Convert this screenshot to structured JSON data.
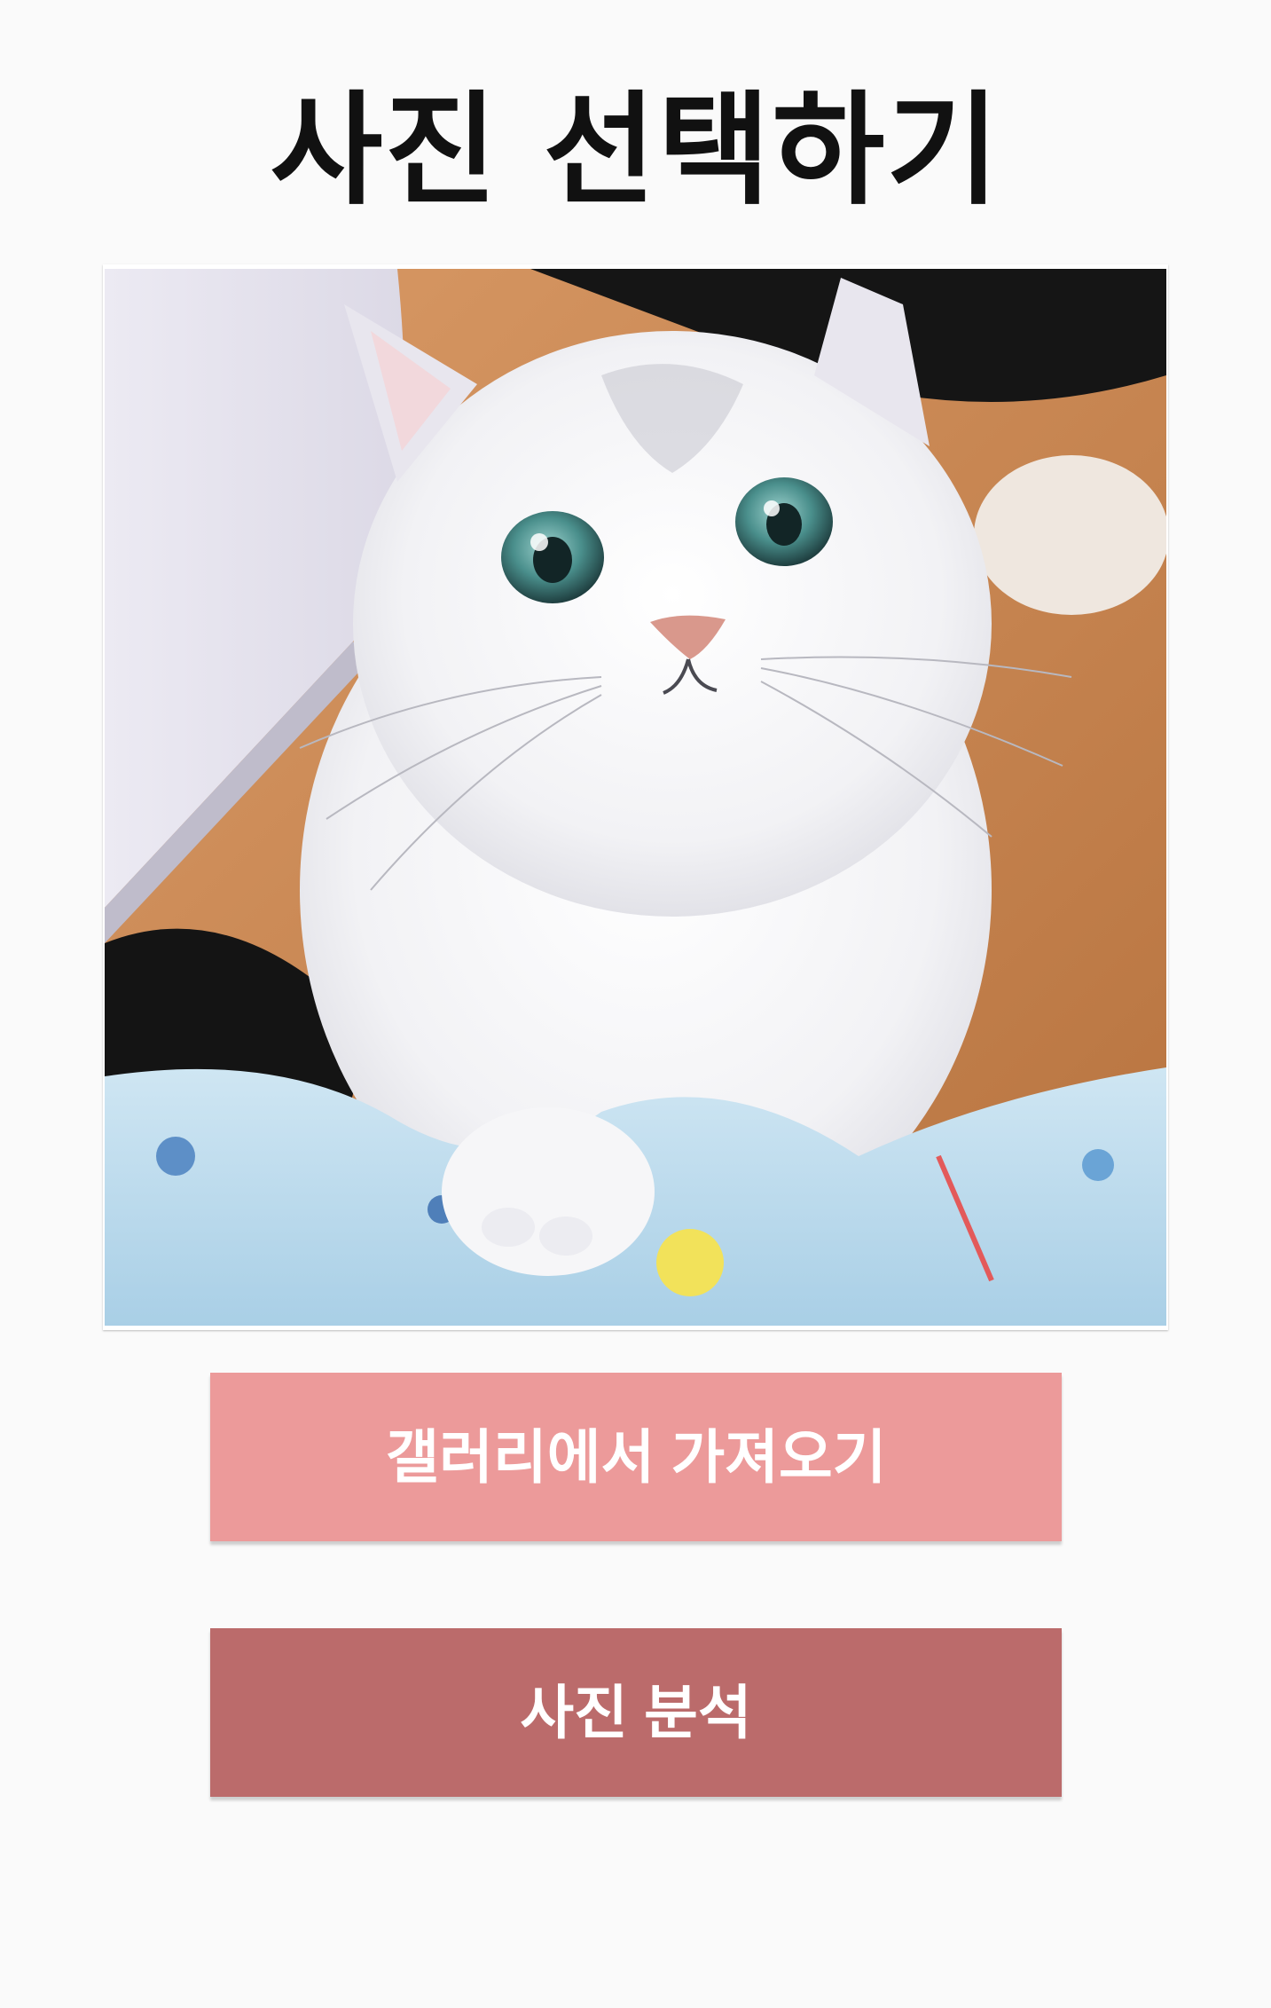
{
  "header": {
    "title": "사진 선택하기"
  },
  "photo": {
    "subject": "white-persian-cat"
  },
  "actions": {
    "gallery_label": "갤러리에서 가져오기",
    "analyze_label": "사진 분석"
  },
  "colors": {
    "background": "#fafafa",
    "gallery_button": "#ec9a9a",
    "analyze_button": "#bb6b6b",
    "button_text": "#ffffff",
    "title_text": "#111111"
  }
}
